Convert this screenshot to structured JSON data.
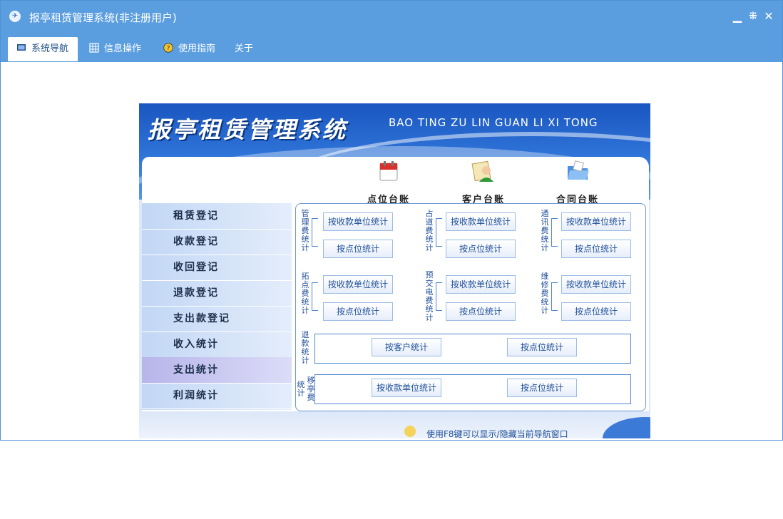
{
  "window": {
    "title": "报亭租赁管理系统(非注册用户)",
    "controls": [
      "minimize-icon",
      "restore-icon",
      "close-icon"
    ]
  },
  "menu": [
    {
      "label": "系统导航",
      "icon": "monitor-icon",
      "active": true
    },
    {
      "label": "信息操作",
      "icon": "grid-icon",
      "active": false
    },
    {
      "label": "使用指南",
      "icon": "help-icon",
      "active": false
    },
    {
      "label": "关于",
      "icon": "",
      "active": false
    }
  ],
  "banner": {
    "title_cn": "报亭租赁管理系统",
    "title_en": "BAO TING ZU LIN GUAN LI XI TONG"
  },
  "quick_links": [
    {
      "label": "点位台账",
      "icon": "calendar-icon"
    },
    {
      "label": "客户台账",
      "icon": "customer-icon"
    },
    {
      "label": "合同台账",
      "icon": "folder-icon"
    }
  ],
  "sidebar": [
    {
      "label": "租赁登记"
    },
    {
      "label": "收款登记"
    },
    {
      "label": "收回登记"
    },
    {
      "label": "退款登记"
    },
    {
      "label": "支出款登记"
    },
    {
      "label": "收入统计"
    },
    {
      "label": "支出统计",
      "active": true
    },
    {
      "label": "利润统计"
    }
  ],
  "stats": {
    "groups": [
      {
        "label": "管理费统计",
        "btn1": "按收款单位统计",
        "btn2": "按点位统计"
      },
      {
        "label": "占道费统计",
        "btn1": "按收款单位统计",
        "btn2": "按点位统计"
      },
      {
        "label": "通讯费统计",
        "btn1": "按收款单位统计",
        "btn2": "按点位统计"
      },
      {
        "label": "拓点费统计",
        "btn1": "按收款单位统计",
        "btn2": "按点位统计"
      },
      {
        "label": "预交电费统计",
        "btn1": "按收款单位统计",
        "btn2": "按点位统计"
      },
      {
        "label": "维修费统计",
        "btn1": "按收款单位统计",
        "btn2": "按点位统计"
      }
    ],
    "refund": {
      "label": "退款统计",
      "btn1": "按客户统计",
      "btn2": "按点位统计"
    },
    "move": {
      "label1": "移亭费",
      "label2": "统计",
      "btn1": "按收款单位统计",
      "btn2": "按点位统计"
    }
  },
  "tip": "使用F8键可以显示/隐藏当前导航窗口",
  "colors": {
    "titlebar": "#5b9ee0",
    "banner": "#2f74d8",
    "accent": "#1f4f99"
  }
}
